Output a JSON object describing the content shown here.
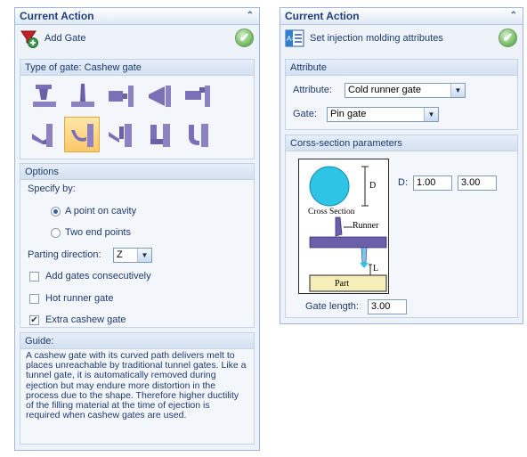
{
  "left": {
    "header": {
      "title": "Current Action",
      "collapse_glyph": "⌃"
    },
    "action": {
      "label": "Add Gate",
      "icon": "add-gate-icon",
      "ok_icon": "checkmark-icon"
    },
    "gate_type": {
      "title": "Type of gate: Cashew gate",
      "gates": [
        {
          "name": "direct-gate-icon",
          "selected": false
        },
        {
          "name": "pin-gate-icon",
          "selected": false
        },
        {
          "name": "side-gate-icon",
          "selected": false
        },
        {
          "name": "fan-gate-icon",
          "selected": false
        },
        {
          "name": "overlap-gate-icon",
          "selected": false
        },
        {
          "name": "submarine-gate-icon",
          "selected": false
        },
        {
          "name": "cashew-gate-icon",
          "selected": true
        },
        {
          "name": "tunnel-gate-icon",
          "selected": false
        },
        {
          "name": "hook-gate-icon",
          "selected": false
        }
      ]
    },
    "options": {
      "title": "Options",
      "specify_by": "Specify by:",
      "radio_point": "A point on cavity",
      "radio_two": "Two end points",
      "parting_label": "Parting direction:",
      "parting_value": "Z",
      "cb_consecutive": "Add gates consecutively",
      "cb_hot_runner": "Hot runner gate",
      "cb_extra_cashew": "Extra cashew gate"
    },
    "guide": {
      "title": "Guide:",
      "text": "A cashew gate with its curved path delivers melt to places unreachable by traditional tunnel gates. Like a tunnel gate, it is automatically removed during ejection but may endure more distortion in the process due to the shape. Therefore higher ductility of the filling material at the time of ejection is required when cashew gates are used."
    }
  },
  "right": {
    "header": {
      "title": "Current Action",
      "collapse_glyph": "⌃"
    },
    "action": {
      "label": "Set injection molding attributes",
      "icon": "attributes-icon",
      "ok_icon": "checkmark-icon"
    },
    "attribute": {
      "title": "Attribute",
      "attr_label": "Attribute:",
      "attr_value": "Cold runner gate",
      "gate_label": "Gate:",
      "gate_value": "Pin gate"
    },
    "cross": {
      "title": "Corss-section parameters",
      "d_label": "D:",
      "d_value1": "1.00",
      "d_value2": "3.00",
      "diagram": {
        "d": "D",
        "cross_section": "Cross Section",
        "runner": "Runner",
        "l": "L",
        "part": "Part"
      },
      "gate_length_label": "Gate length:",
      "gate_length_value": "3.00"
    }
  },
  "colors": {
    "panel_border": "#9db9df",
    "selected_gate": "#fcc86a",
    "icon_purple": "#6b5fa8",
    "circle_cyan": "#2ec4e6",
    "part_fill": "#f6eeb8"
  }
}
